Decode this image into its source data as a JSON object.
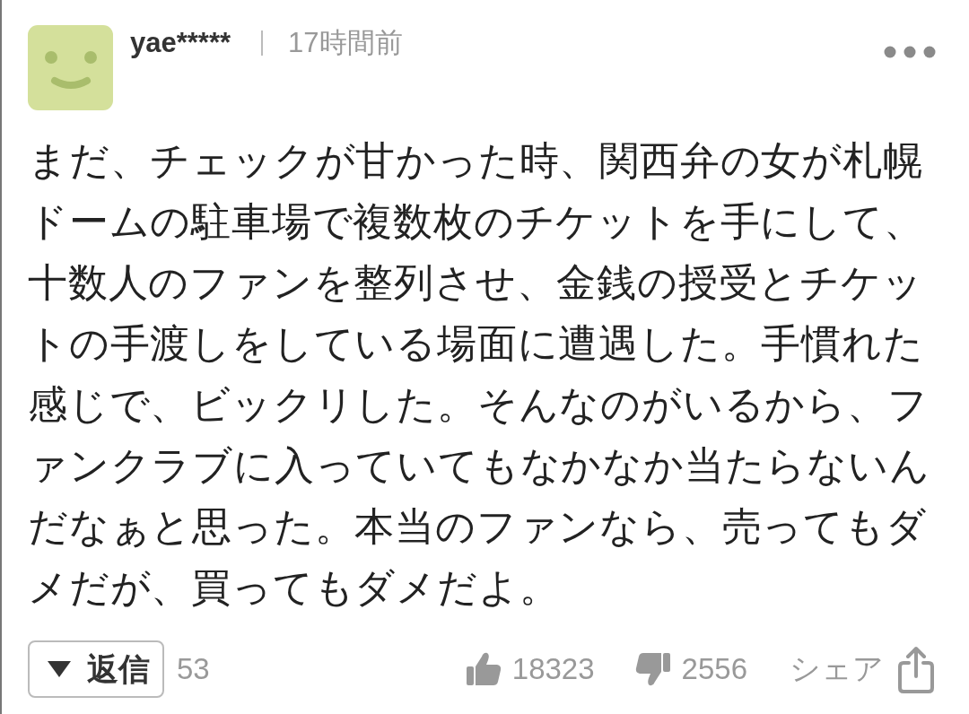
{
  "comment": {
    "author": "yae*****",
    "time": "17時間前",
    "body": "まだ、チェックが甘かった時、関西弁の女が札幌ドームの駐車場で複数枚のチケットを手にして、十数人のファンを整列させ、金銭の授受とチケットの手渡しをしている場面に遭遇した。手慣れた感じで、ビックリした。そんなのがいるから、ファンクラブに入っていてもなかなか当たらないんだなぁと思った。本当のファンなら、売ってもダメだが、買ってもダメだよ。",
    "reply_button": {
      "label": "返信"
    },
    "reply_count": "53",
    "likes": "18323",
    "dislikes": "2556",
    "share_button": {
      "label": "シェア"
    }
  }
}
